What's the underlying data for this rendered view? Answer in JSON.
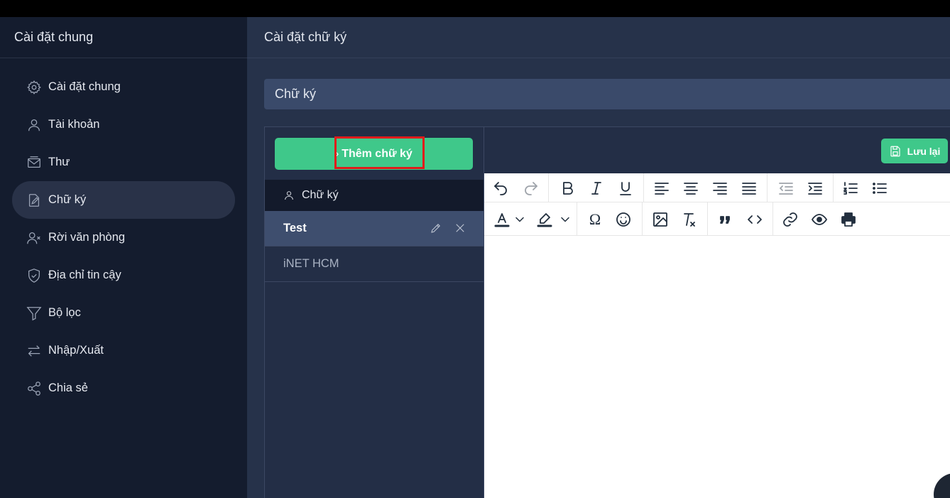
{
  "sidebar": {
    "title": "Cài đặt chung",
    "items": [
      {
        "label": "Cài đặt chung",
        "icon": "gear-icon"
      },
      {
        "label": "Tài khoản",
        "icon": "user-icon"
      },
      {
        "label": "Thư",
        "icon": "mail-icon"
      },
      {
        "label": "Chữ ký",
        "icon": "signature-icon",
        "active": true
      },
      {
        "label": "Rời văn phòng",
        "icon": "user-away-icon"
      },
      {
        "label": "Địa chỉ tin cậy",
        "icon": "shield-icon"
      },
      {
        "label": "Bộ lọc",
        "icon": "filter-icon"
      },
      {
        "label": "Nhập/Xuất",
        "icon": "import-export-icon"
      },
      {
        "label": "Chia sẻ",
        "icon": "share-icon"
      }
    ]
  },
  "main": {
    "title": "Cài đặt chữ ký",
    "section_title": "Chữ ký",
    "add_button": "Thêm chữ ký",
    "add_button_chevron": "›",
    "list_header": "Chữ ký",
    "signatures": [
      {
        "name": "Test",
        "active": true
      },
      {
        "name": "iNET HCM",
        "active": false
      }
    ],
    "save_button": "Lưu lại"
  },
  "colors": {
    "sidebar_bg": "#141c2e",
    "main_bg": "#26324a",
    "accent_green": "#3fc88a",
    "highlight_red": "#e01b1b"
  },
  "editor": {
    "toolbar_row1": [
      "undo-icon",
      "redo-icon",
      "bold-icon",
      "italic-icon",
      "underline-icon",
      "align-left-icon",
      "align-center-icon",
      "align-right-icon",
      "align-justify-icon",
      "outdent-icon",
      "indent-icon",
      "numbered-list-icon",
      "bullet-list-icon"
    ],
    "toolbar_row2": [
      "text-color-icon",
      "highlight-color-icon",
      "special-char-icon",
      "emoji-icon",
      "image-icon",
      "clear-format-icon",
      "blockquote-icon",
      "code-icon",
      "link-icon",
      "preview-icon",
      "print-icon"
    ],
    "special_char_glyph": "Ω"
  }
}
